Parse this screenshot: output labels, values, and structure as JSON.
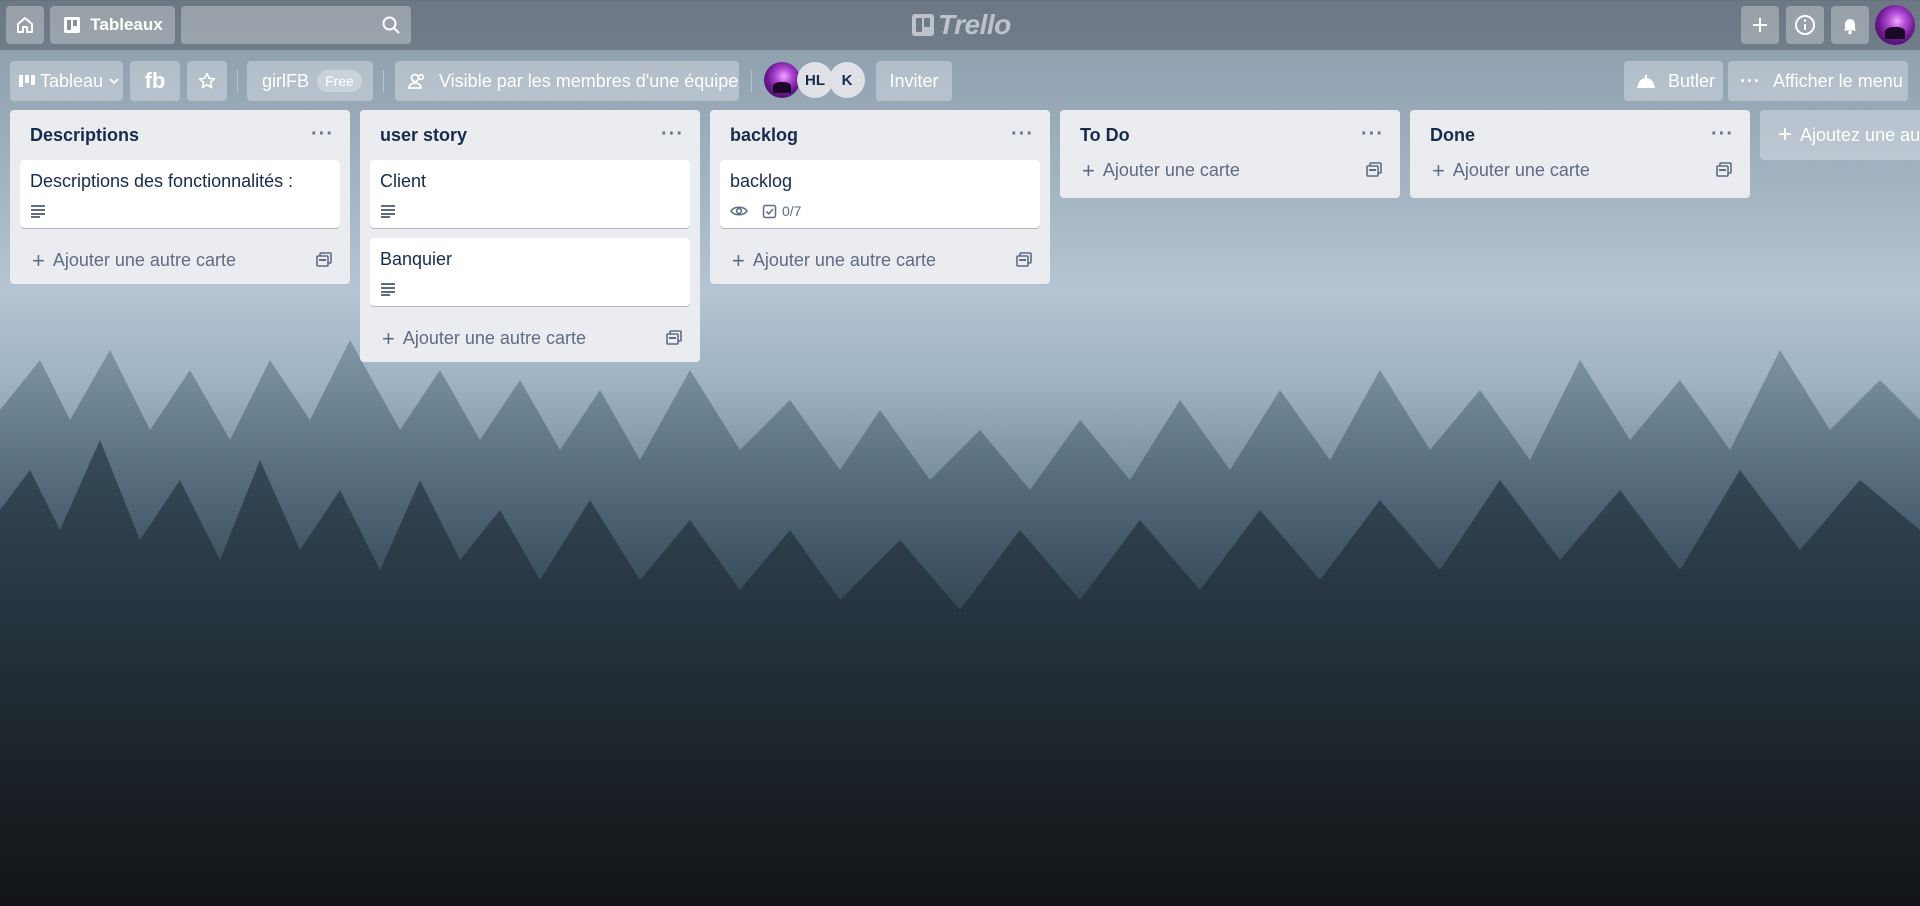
{
  "topbar": {
    "home_icon": "home-icon",
    "boards_label": "Tableaux",
    "search_placeholder": "",
    "logo_text": "Trello",
    "create_icon": "plus-icon",
    "info_icon": "info-icon",
    "notifications_icon": "bell-icon"
  },
  "boardbar": {
    "view_label": "Tableau",
    "board_name": "fb",
    "team_name": "girlFB",
    "team_plan": "Free",
    "visibility_label": "Visible par les membres d'une équipe",
    "members": [
      "HL",
      "K"
    ],
    "invite_label": "Inviter",
    "butler_label": "Butler",
    "menu_label": "Afficher le menu"
  },
  "lists": [
    {
      "title": "Descriptions",
      "cards": [
        {
          "title": "Descriptions des fonctionnalités :",
          "has_description": true
        }
      ],
      "add_label": "Ajouter une autre carte"
    },
    {
      "title": "user story",
      "cards": [
        {
          "title": "Client",
          "has_description": true
        },
        {
          "title": "Banquier",
          "has_description": true
        }
      ],
      "add_label": "Ajouter une autre carte"
    },
    {
      "title": "backlog",
      "cards": [
        {
          "title": "backlog",
          "watching": true,
          "checklist": "0/7"
        }
      ],
      "add_label": "Ajouter une autre carte"
    },
    {
      "title": "To Do",
      "cards": [],
      "add_label": "Ajouter une carte"
    },
    {
      "title": "Done",
      "cards": [],
      "add_label": "Ajouter une carte"
    }
  ],
  "add_list_label": "Ajoutez une autre liste",
  "colors": {
    "list_bg": "#ebecf0",
    "text": "#172b4d",
    "muted": "#5e6c84"
  }
}
